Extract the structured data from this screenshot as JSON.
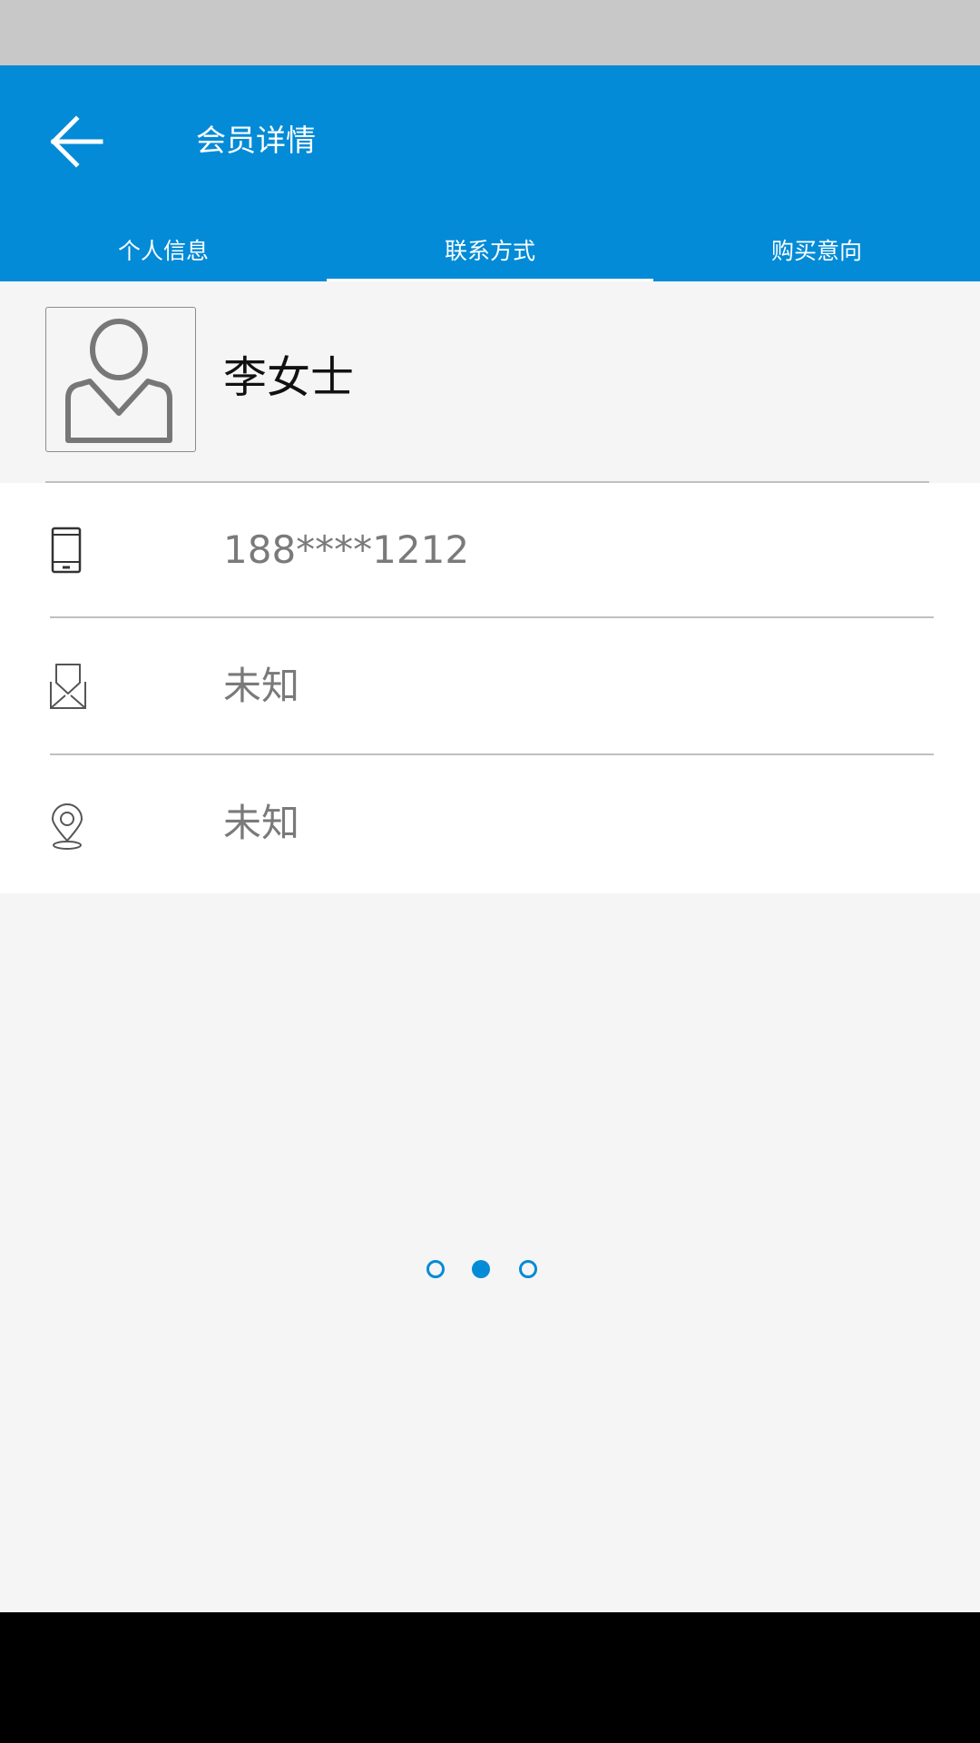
{
  "app_bar": {
    "title": "会员详情",
    "back_icon": "arrow-left-icon",
    "background_color": "#038bd7"
  },
  "tabs": [
    {
      "label": "个人信息",
      "selected": false
    },
    {
      "label": "联系方式",
      "selected": true
    },
    {
      "label": "购买意向",
      "selected": false
    }
  ],
  "member": {
    "name": "李女士",
    "avatar_icon": "person-placeholder-icon"
  },
  "contacts": [
    {
      "icon": "mobile-phone-icon",
      "value": "188****1212"
    },
    {
      "icon": "mail-inbox-icon",
      "value": "未知"
    },
    {
      "icon": "location-pin-icon",
      "value": "未知"
    }
  ],
  "pager": {
    "count": 3,
    "active_index": 1,
    "color": "#038bd7"
  }
}
